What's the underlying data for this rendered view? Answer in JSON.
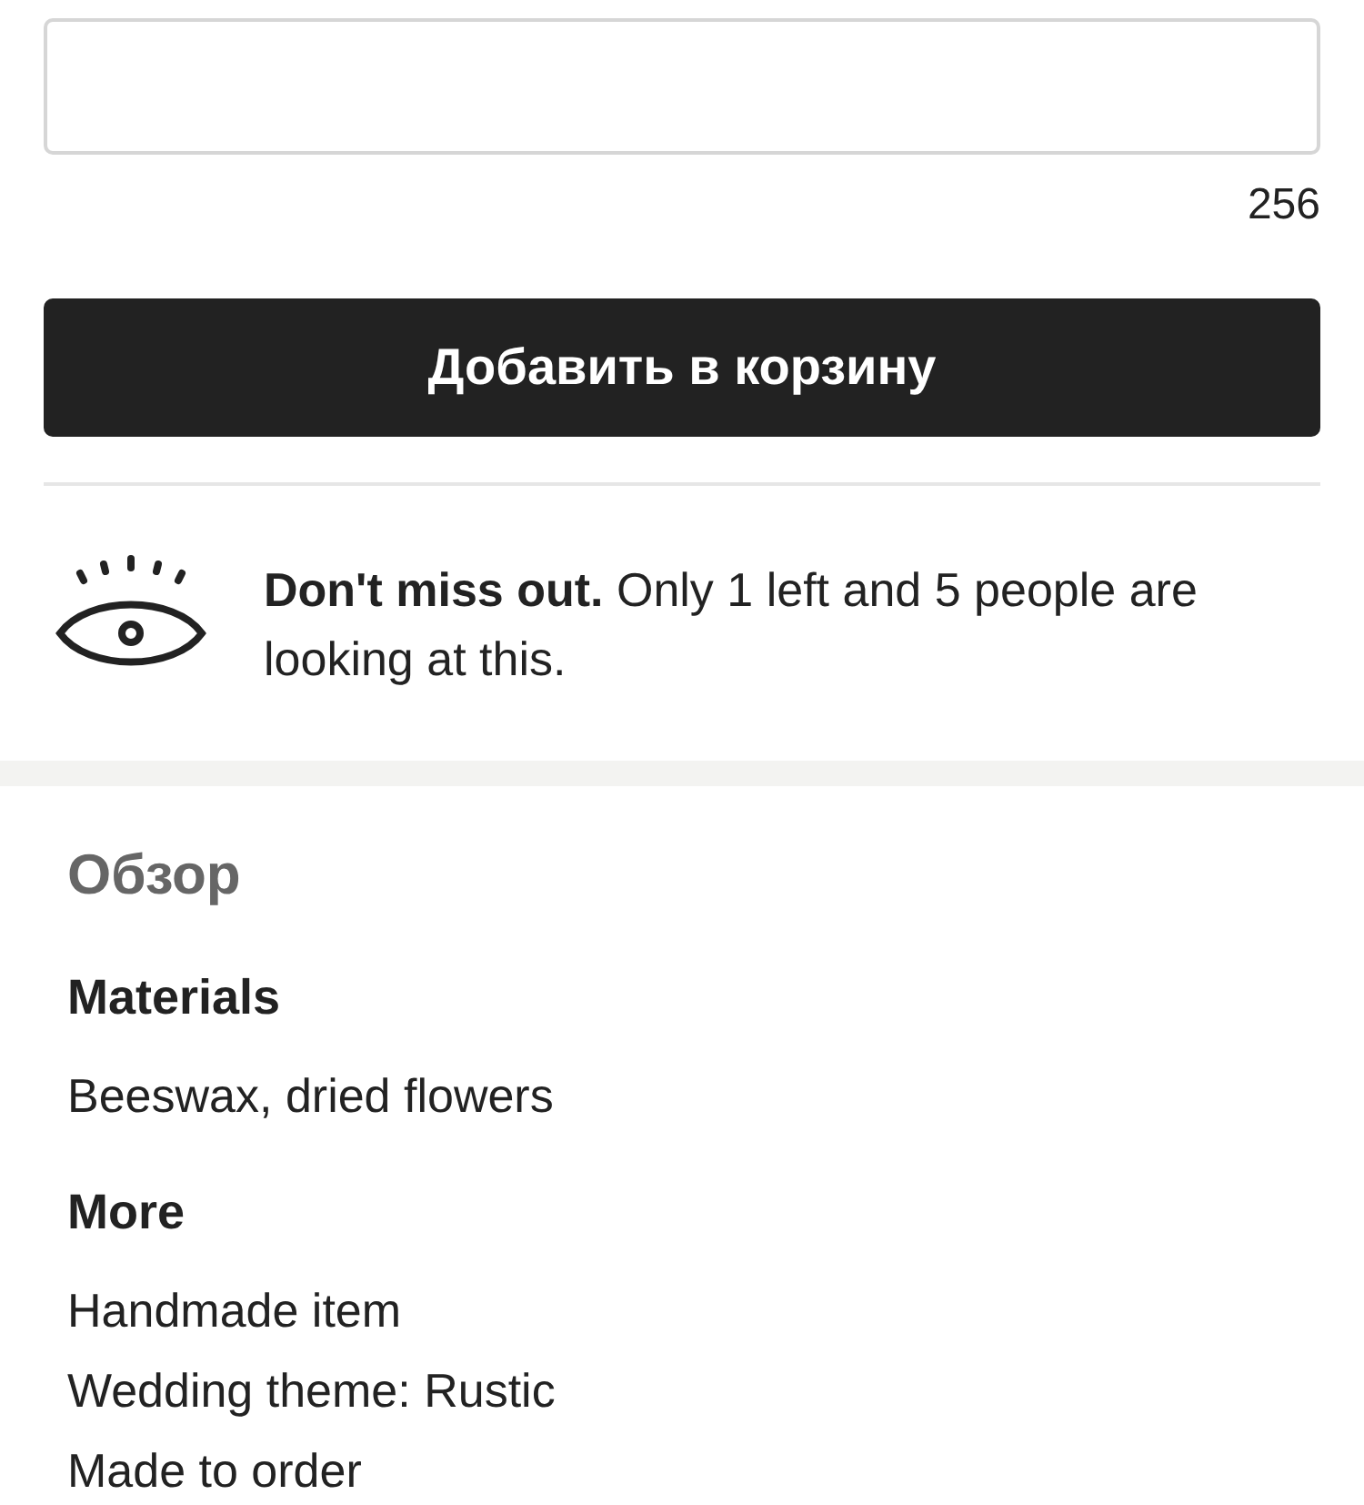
{
  "note_field": {
    "remaining_characters": "256"
  },
  "add_to_cart_button": {
    "label": "Добавить в корзину"
  },
  "scarcity_notice": {
    "text": "**Don't miss out.** Only 1 left and 5 people are looking at this."
  },
  "overview": {
    "title": "Обзор",
    "sections": [
      {
        "heading": "Materials",
        "items": [
          "Beeswax, dried flowers"
        ]
      },
      {
        "heading": "More",
        "items": [
          "Handmade item",
          "Wedding theme: Rustic",
          "Made to order"
        ]
      }
    ]
  }
}
